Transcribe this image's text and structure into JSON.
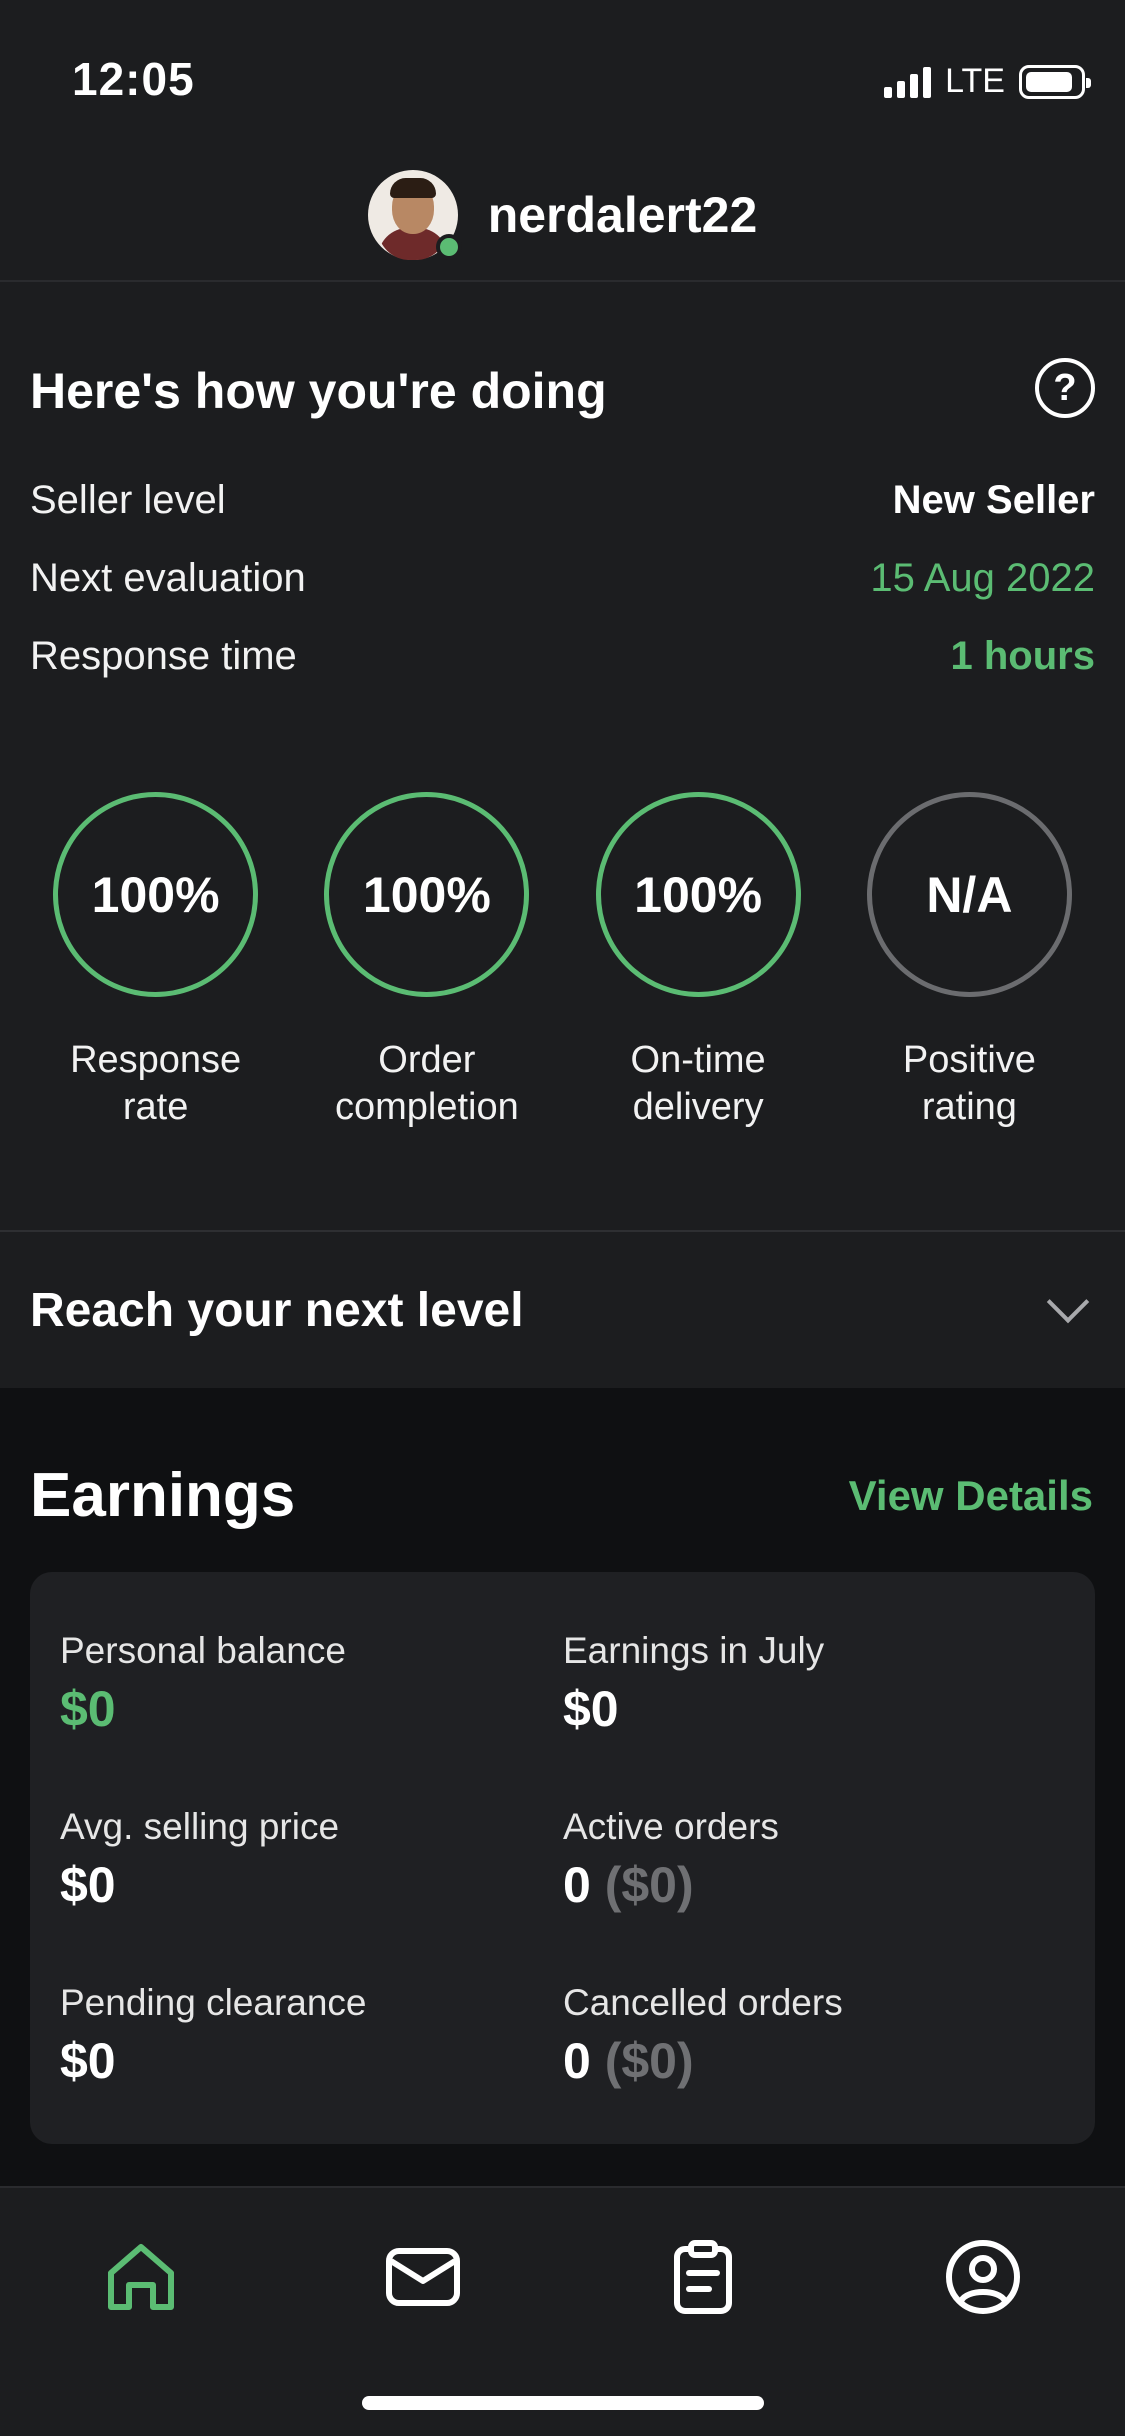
{
  "status_bar": {
    "time": "12:05",
    "network": "LTE"
  },
  "profile": {
    "username": "nerdalert22",
    "online": true
  },
  "performance": {
    "title": "Here's how you're doing",
    "rows": [
      {
        "label": "Seller level",
        "value": "New Seller"
      },
      {
        "label": "Next evaluation",
        "value": "15 Aug 2022"
      },
      {
        "label": "Response time",
        "value": "1 hours"
      }
    ],
    "metrics": [
      {
        "value": "100%",
        "label_line1": "Response",
        "label_line2": "rate"
      },
      {
        "value": "100%",
        "label_line1": "Order",
        "label_line2": "completion"
      },
      {
        "value": "100%",
        "label_line1": "On-time",
        "label_line2": "delivery"
      },
      {
        "value": "N/A",
        "label_line1": "Positive",
        "label_line2": "rating"
      }
    ]
  },
  "reach": {
    "title": "Reach your next level"
  },
  "earnings": {
    "title": "Earnings",
    "view_details": "View Details",
    "cells": [
      {
        "label": "Personal balance",
        "value": "$0"
      },
      {
        "label": "Earnings in July",
        "value": "$0"
      },
      {
        "label": "Avg. selling price",
        "value": "$0"
      },
      {
        "label": "Active orders",
        "count": "0",
        "amount": "($0)"
      },
      {
        "label": "Pending clearance",
        "value": "$0"
      },
      {
        "label": "Cancelled orders",
        "count": "0",
        "amount": "($0)"
      }
    ]
  },
  "tabbar": {
    "icons": [
      "home-icon",
      "inbox-icon",
      "orders-icon",
      "profile-icon"
    ],
    "active": "home-icon"
  },
  "colors": {
    "accent": "#5bbc73",
    "background": "#1c1d1f",
    "earnings_bg": "#0f1012",
    "card": "#1f2023",
    "muted": "#6f7073"
  }
}
